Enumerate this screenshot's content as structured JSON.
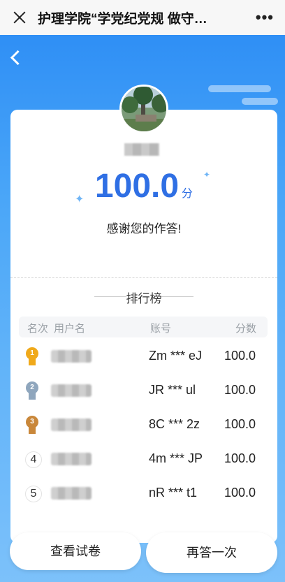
{
  "topbar": {
    "title": "护理学院“学党纪党规 做守…"
  },
  "result": {
    "score": "100.0",
    "unit": "分",
    "thanks": "感谢您的作答!"
  },
  "ranking": {
    "title": "排行榜",
    "headers": {
      "rank": "名次",
      "user": "用户名",
      "account": "账号",
      "score": "分数"
    },
    "rows": [
      {
        "rank": "1",
        "account": "Zm *** eJ",
        "score": "100.0"
      },
      {
        "rank": "2",
        "account": "JR *** ul",
        "score": "100.0"
      },
      {
        "rank": "3",
        "account": "8C *** 2z",
        "score": "100.0"
      },
      {
        "rank": "4",
        "account": "4m *** JP",
        "score": "100.0"
      },
      {
        "rank": "5",
        "account": "nR *** t1",
        "score": "100.0"
      }
    ]
  },
  "buttons": {
    "view": "查看试卷",
    "retry": "再答一次"
  },
  "colors": {
    "accent": "#2f6fe4",
    "gold": "#f0a91a",
    "silver": "#8fa6bd",
    "bronze": "#c9873a"
  }
}
